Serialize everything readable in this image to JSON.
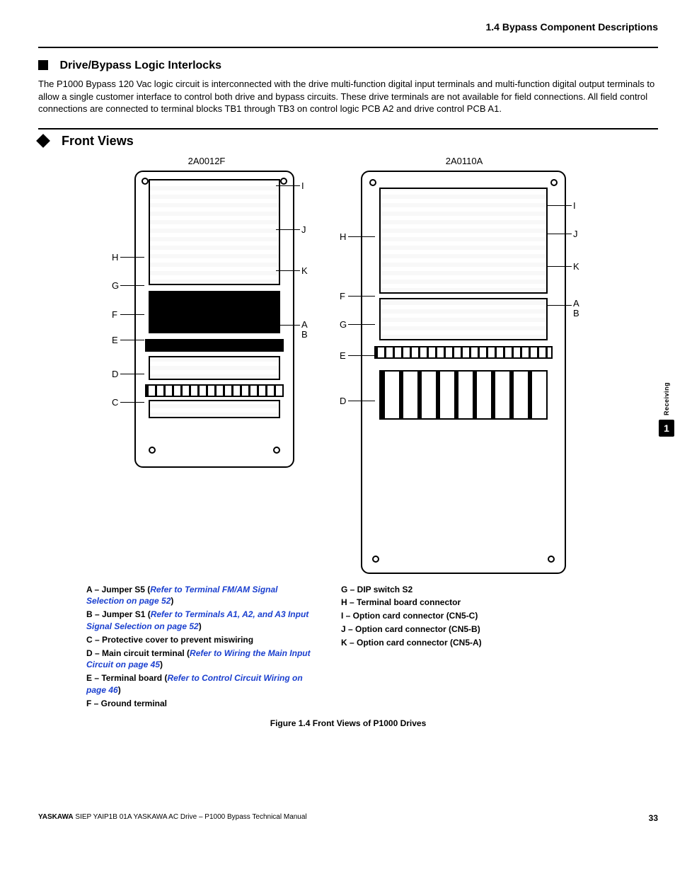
{
  "header": {
    "running": "1.4 Bypass Component Descriptions"
  },
  "section1": {
    "title": "Drive/Bypass Logic Interlocks",
    "body": "The P1000 Bypass 120 Vac logic circuit is interconnected with the drive multi-function digital input terminals and multi-function digital output terminals to allow a single customer interface to control both drive and bypass circuits. These drive terminals are not available for field connections. All field control connections are connected to terminal blocks TB1 through TB3 on control logic PCB A2 and drive control PCB A1."
  },
  "section2": {
    "title": "Front Views"
  },
  "figure": {
    "panel1_title": "2A0012F",
    "panel2_title": "2A0110A",
    "caption": "Figure 1.4  Front Views of P1000 Drives",
    "labels": [
      "A",
      "B",
      "C",
      "D",
      "E",
      "F",
      "G",
      "H",
      "I",
      "J",
      "K"
    ]
  },
  "legend_left": [
    {
      "key": "A",
      "pre": "Jumper S5 (",
      "ref": "Refer to Terminal FM/AM Signal Selection on page 52",
      "post": ")"
    },
    {
      "key": "B",
      "pre": "Jumper S1 (",
      "ref": "Refer to Terminals A1, A2, and A3 Input Signal Selection on page 52",
      "post": ")"
    },
    {
      "key": "C",
      "pre": "Protective cover to prevent miswiring",
      "ref": "",
      "post": ""
    },
    {
      "key": "D",
      "pre": "Main circuit terminal (",
      "ref": "Refer to Wiring the Main Input Circuit on page 45",
      "post": ")"
    },
    {
      "key": "E",
      "pre": "Terminal board (",
      "ref": "Refer to Control Circuit Wiring on page 46",
      "post": ")"
    },
    {
      "key": "F",
      "pre": "Ground terminal",
      "ref": "",
      "post": ""
    }
  ],
  "legend_right": [
    {
      "key": "G",
      "text": "DIP switch S2"
    },
    {
      "key": "H",
      "text": "Terminal board connector"
    },
    {
      "key": "I",
      "text": "Option card connector (CN5-C)"
    },
    {
      "key": "J",
      "text": "Option card connector (CN5-B)"
    },
    {
      "key": "K",
      "text": "Option card connector (CN5-A)"
    }
  ],
  "sidetab": {
    "label": "Receiving",
    "chapter": "1"
  },
  "footer": {
    "mfg": "YASKAWA",
    "doc": " SIEP YAIP1B 01A YASKAWA AC Drive – P1000 Bypass Technical Manual",
    "page": "33"
  }
}
